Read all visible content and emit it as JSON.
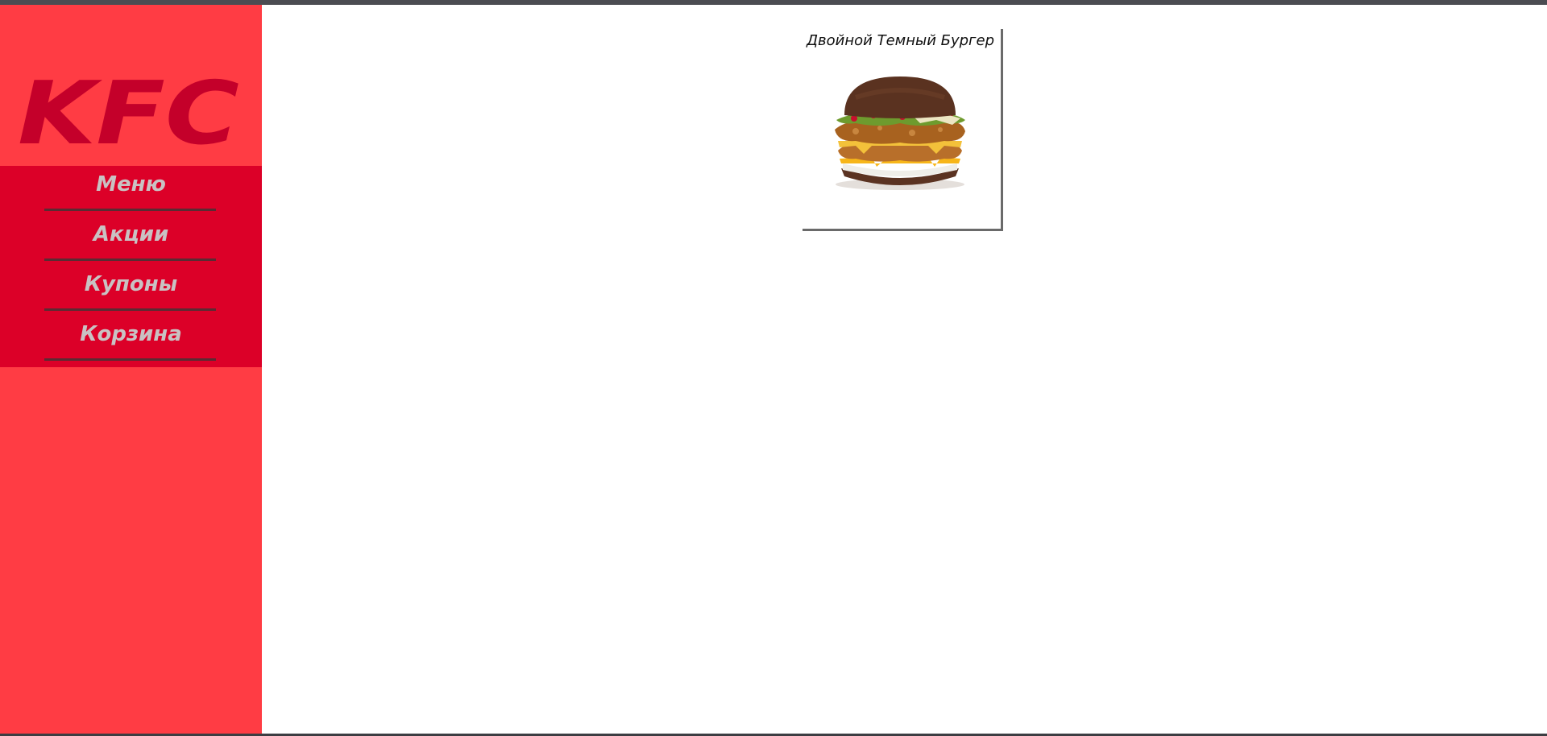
{
  "sidebar": {
    "logo_text": "KFC",
    "nav_items": [
      {
        "label": "Меню"
      },
      {
        "label": "Акции"
      },
      {
        "label": "Купоны"
      },
      {
        "label": "Корзина"
      }
    ]
  },
  "main": {
    "products": [
      {
        "title": "Двойной Темный Бургер",
        "image": "burger-image"
      }
    ]
  },
  "colors": {
    "sidebar_bg": "#ff3c44",
    "nav_bg": "#dc0028",
    "logo": "#c4002a",
    "nav_text": "#c9c2c3"
  }
}
